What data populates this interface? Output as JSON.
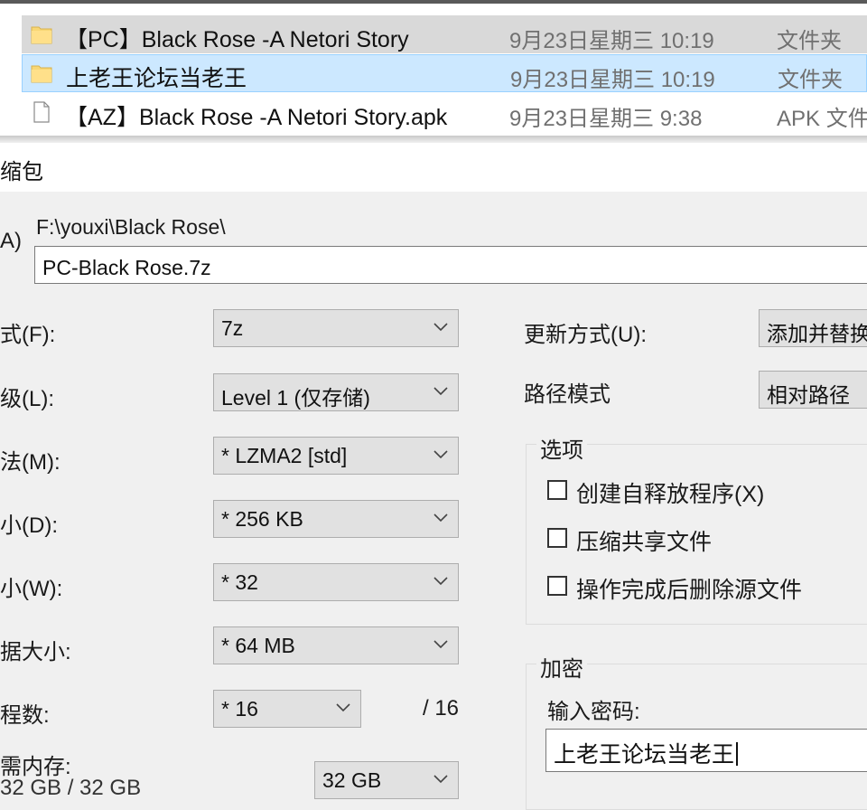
{
  "explorer": {
    "files": [
      {
        "name": "【PC】Black Rose -A Netori Story",
        "date": "9月23日星期三 10:19",
        "type": "文件夹",
        "icon": "folder-icon"
      },
      {
        "name": "上老王论坛当老王",
        "date": "9月23日星期三 10:19",
        "type": "文件夹",
        "icon": "folder-icon"
      },
      {
        "name": "【AZ】Black Rose -A Netori Story.apk",
        "date": "9月23日星期三 9:38",
        "type": "APK 文件",
        "icon": "file-icon"
      }
    ]
  },
  "dialog": {
    "title": "缩包",
    "archive_label": "A)",
    "path": "F:\\youxi\\Black Rose\\",
    "archive_name": "PC-Black Rose.7z",
    "left_fields": [
      {
        "label": "式(F):",
        "value": "7z"
      },
      {
        "label": "级(L):",
        "value": "Level 1 (仅存储)"
      },
      {
        "label": "法(M):",
        "value": "*  LZMA2 [std]"
      },
      {
        "label": "小(D):",
        "value": "*  256 KB"
      },
      {
        "label": "小(W):",
        "value": "*  32"
      },
      {
        "label": "据大小:",
        "value": "*  64 MB"
      },
      {
        "label": "程数:",
        "value": "*  16"
      }
    ],
    "threads_max": "/ 16",
    "memory_label": "需内存:",
    "memory_value": "32 GB / 32 GB",
    "memory_combo": "32 GB",
    "update_mode_label": "更新方式(U):",
    "update_mode_value": "添加并替换",
    "path_mode_label": "路径模式",
    "path_mode_value": "相对路径",
    "options": {
      "title": "选项",
      "items": [
        {
          "label": "创建自释放程序(X)",
          "checked": false
        },
        {
          "label": "压缩共享文件",
          "checked": false
        },
        {
          "label": "操作完成后删除源文件",
          "checked": false
        }
      ]
    },
    "encryption": {
      "title": "加密",
      "password_label": "输入密码:",
      "password_value": "上老王论坛当老王"
    }
  },
  "colors": {
    "selected_row": "#cce8ff",
    "selected_border": "#99d1ff",
    "hover_row": "#d9d9d9",
    "dialog_bg": "#f0f0f0",
    "folder": "#f8d775"
  }
}
